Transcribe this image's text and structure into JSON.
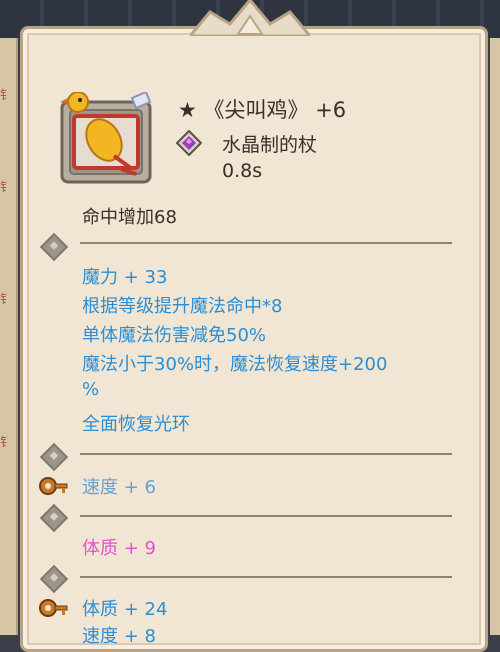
{
  "item": {
    "star": "★",
    "name": "《尖叫鸡》",
    "level": "+6",
    "type": "水晶制的杖",
    "speed": "0.8s",
    "bonus": "命中增加68"
  },
  "attributes": [
    "魔力 + 33",
    "根据等级提升魔法命中*8",
    "单体魔法伤害减免50%",
    "魔法小于30%时，魔法恢复速度+200",
    "%",
    "全面恢复光环"
  ],
  "sockets": {
    "speed": "速度 + 6",
    "constitution": "体质 + 9",
    "constitution2": "体质 + 24",
    "speed_partial": "速度 + 8"
  },
  "colors": {
    "panel": "#f1e5d3",
    "text_dark": "#3b2f2a",
    "stat_blue": "#2a8fd6",
    "stat_pink": "#e352c8",
    "gem_purple": "#9b3fb8"
  },
  "icons": [
    "rubber-chicken-icon",
    "crystal-icon",
    "socket-diamond-icon",
    "bronze-key-icon"
  ]
}
